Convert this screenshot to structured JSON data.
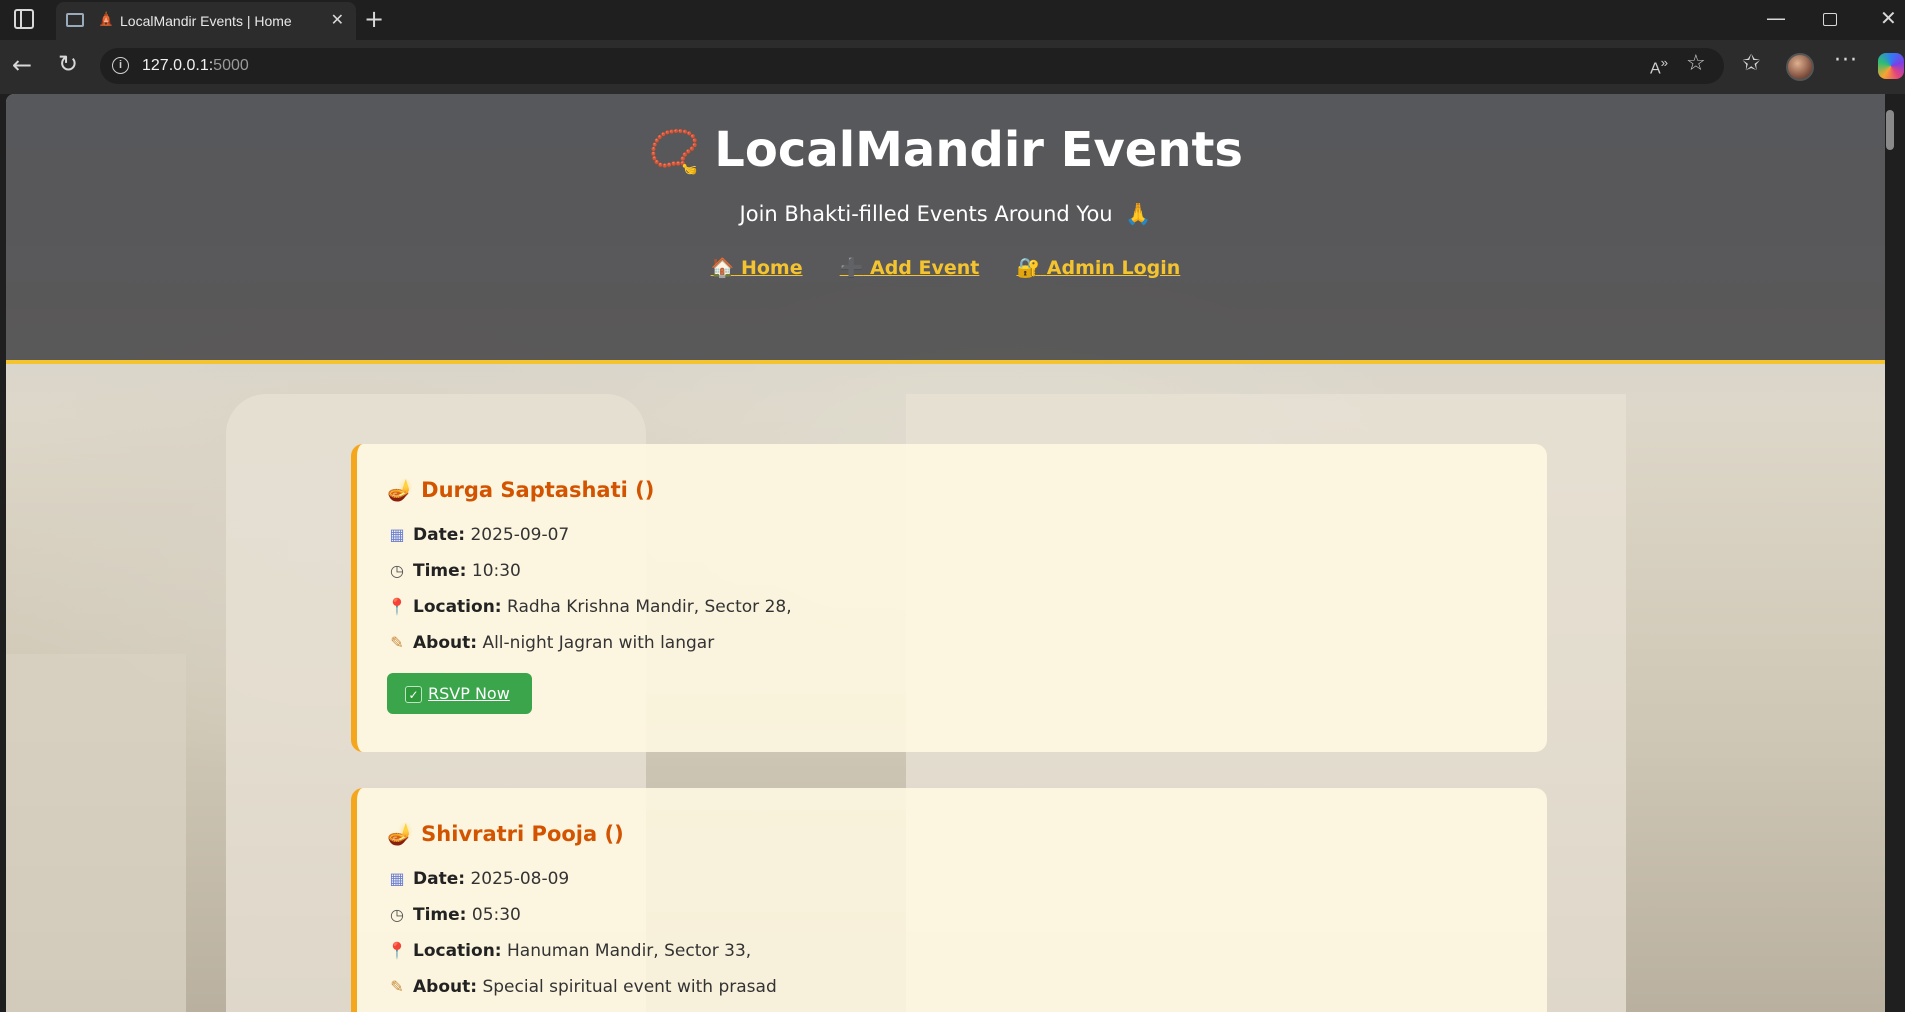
{
  "browser": {
    "tab_title": "LocalMandir Events | Home",
    "url_host": "127.0.0.1:",
    "url_port": "5000"
  },
  "header": {
    "title": "LocalMandir Events",
    "title_emoji": "📿",
    "tagline": "Join Bhakti-filled Events Around You",
    "tagline_emoji": "🙏",
    "nav": [
      {
        "icon": "🏠",
        "label": "Home"
      },
      {
        "icon": "➕",
        "label": "Add Event"
      },
      {
        "icon": "🔐",
        "label": "Admin Login"
      }
    ],
    "accent_color": "#f4c430"
  },
  "labels": {
    "date": "Date:",
    "time": "Time:",
    "location": "Location:",
    "about": "About:",
    "rsvp": "RSVP Now"
  },
  "events": [
    {
      "title": "Durga Saptashati ()",
      "date": "2025-09-07",
      "time": "10:30",
      "location": "Radha Krishna Mandir, Sector 28,",
      "about": "All-night Jagran with langar"
    },
    {
      "title": "Shivratri Pooja ()",
      "date": "2025-08-09",
      "time": "05:30",
      "location": "Hanuman Mandir, Sector 33,",
      "about": "Special spiritual event with prasad"
    }
  ]
}
